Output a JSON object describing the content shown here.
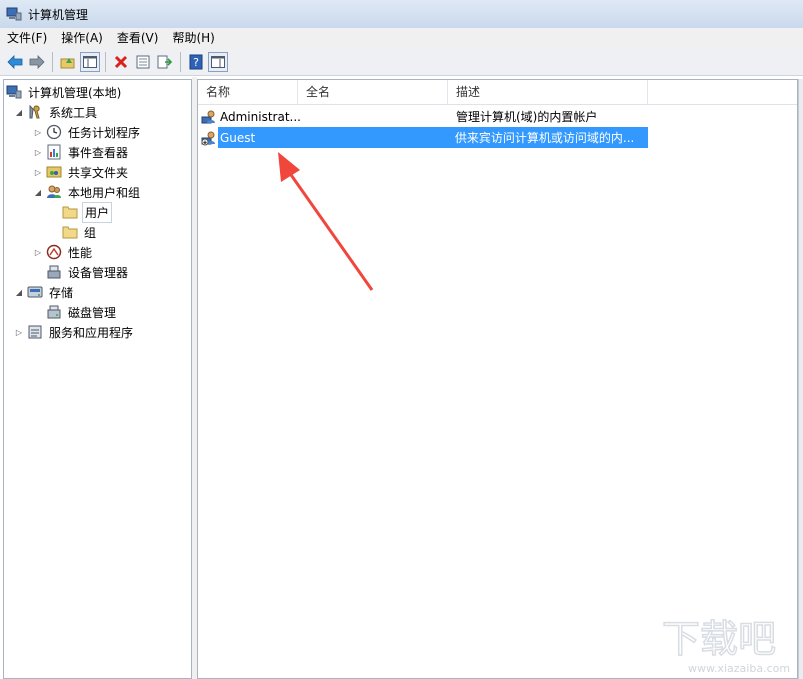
{
  "window": {
    "title": "计算机管理"
  },
  "menu": [
    "文件(F)",
    "操作(A)",
    "查看(V)",
    "帮助(H)"
  ],
  "tree": [
    {
      "label": "计算机管理(本地)",
      "icon": "computer-management-icon",
      "level": 0,
      "expander": ""
    },
    {
      "label": "系统工具",
      "icon": "tools-icon",
      "level": 1,
      "expander": "◢"
    },
    {
      "label": "任务计划程序",
      "icon": "clock-icon",
      "level": 2,
      "expander": "▷"
    },
    {
      "label": "事件查看器",
      "icon": "event-viewer-icon",
      "level": 2,
      "expander": "▷"
    },
    {
      "label": "共享文件夹",
      "icon": "shared-folder-icon",
      "level": 2,
      "expander": "▷"
    },
    {
      "label": "本地用户和组",
      "icon": "users-group-icon",
      "level": 2,
      "expander": "◢"
    },
    {
      "label": "用户",
      "icon": "folder-icon",
      "level": 3,
      "expander": "",
      "selected": true
    },
    {
      "label": "组",
      "icon": "folder-icon",
      "level": 3,
      "expander": ""
    },
    {
      "label": "性能",
      "icon": "performance-icon",
      "level": 2,
      "expander": "▷"
    },
    {
      "label": "设备管理器",
      "icon": "device-manager-icon",
      "level": 2,
      "expander": ""
    },
    {
      "label": "存储",
      "icon": "storage-icon",
      "level": 1,
      "expander": "◢"
    },
    {
      "label": "磁盘管理",
      "icon": "disk-management-icon",
      "level": 2,
      "expander": ""
    },
    {
      "label": "服务和应用程序",
      "icon": "services-icon",
      "level": 1,
      "expander": "▷"
    }
  ],
  "list": {
    "columns": [
      "名称",
      "全名",
      "描述"
    ],
    "rows": [
      {
        "name": "Administrat...",
        "fullname": "",
        "description": "管理计算机(域)的内置帐户",
        "selected": false
      },
      {
        "name": "Guest",
        "fullname": "",
        "description": "供来宾访问计算机或访问域的内...",
        "selected": true
      }
    ]
  },
  "colors": {
    "selection": "#3399ff",
    "arrow": "#f0463c"
  },
  "watermark": {
    "text": "下载吧",
    "url": "www.xiazaiba.com"
  }
}
